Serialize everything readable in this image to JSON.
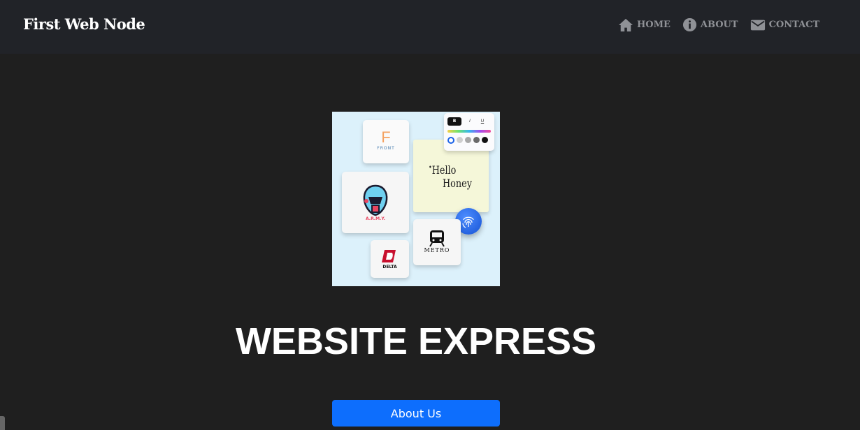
{
  "navbar": {
    "brand": "First Web Node",
    "items": [
      {
        "label": "HOME",
        "icon": "home-icon"
      },
      {
        "label": "ABOUT",
        "icon": "info-icon"
      },
      {
        "label": "CONTACT",
        "icon": "mail-icon"
      }
    ]
  },
  "hero": {
    "image_texts": {
      "front_logo_letter": "F",
      "front_logo_text": "FRONT",
      "army_text": "A.R.M.Y.",
      "note_line1": "Hello",
      "note_line2": "Honey",
      "metro_text": "METRO",
      "delta_text": "DELTA",
      "toolbar_bold": "B",
      "toolbar_italic": "I",
      "toolbar_underline": "U"
    },
    "title": "WEBSITE EXPRESS",
    "button_label": "About Us"
  },
  "colors": {
    "navbar_bg": "#212328",
    "page_bg": "#1f1f1f",
    "button_bg": "#0d6efd",
    "nav_text": "#8f9196"
  }
}
